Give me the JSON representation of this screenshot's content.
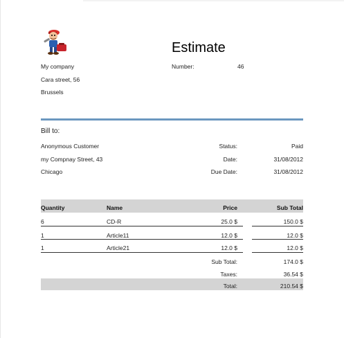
{
  "document": {
    "title": "Estimate",
    "logo_icon": "mechanic-mascot-icon"
  },
  "company": {
    "name": "My company",
    "street": "Cara street, 56",
    "city": "Brussels"
  },
  "number": {
    "label": "Number:",
    "value": "46"
  },
  "bill_to": {
    "heading": "Bill to:",
    "customer": "Anonymous Customer",
    "street": "my Compnay Street, 43",
    "city": "Chicago"
  },
  "meta": {
    "status_label": "Status:",
    "status_value": "Paid",
    "date_label": "Date:",
    "date_value": "31/08/2012",
    "due_label": "Due Date:",
    "due_value": "31/08/2012"
  },
  "table": {
    "headers": [
      "Quantity",
      "Name",
      "Price",
      "Sub Total"
    ],
    "rows": [
      [
        "6",
        "CD-R",
        "25.0 $",
        "150.0 $"
      ],
      [
        "1",
        "Article11",
        "12.0 $",
        "12.0 $"
      ],
      [
        "1",
        "Article21",
        "12.0 $",
        "12.0 $"
      ]
    ]
  },
  "totals": {
    "subtotal_label": "Sub Total:",
    "subtotal_value": "174.0 $",
    "taxes_label": "Taxes:",
    "taxes_value": "36.54 $",
    "total_label": "Total:",
    "total_value": "210.54 $"
  },
  "colors": {
    "divider": "#6b97bf",
    "header_fill": "#d4d4d4"
  }
}
